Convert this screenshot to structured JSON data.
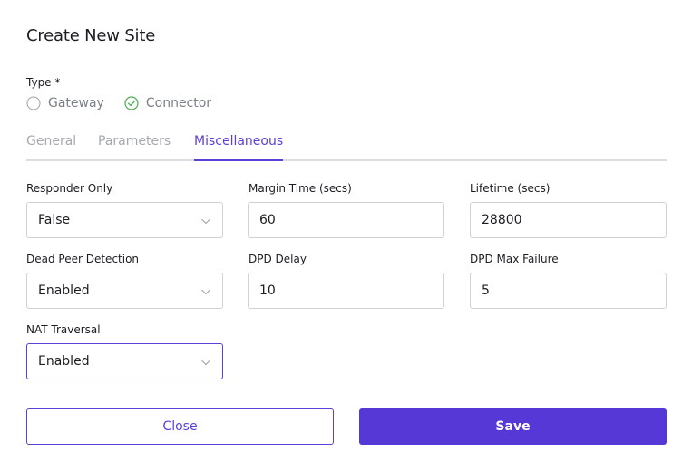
{
  "dialog": {
    "title": "Create New Site"
  },
  "type": {
    "label": "Type *",
    "options": [
      {
        "label": "Gateway",
        "selected": false
      },
      {
        "label": "Connector",
        "selected": true
      }
    ]
  },
  "tabs": [
    {
      "label": "General",
      "active": false
    },
    {
      "label": "Parameters",
      "active": false
    },
    {
      "label": "Miscellaneous",
      "active": true
    }
  ],
  "fields": {
    "responder_only": {
      "label": "Responder Only",
      "value": "False"
    },
    "margin_time": {
      "label": "Margin Time (secs)",
      "value": "60"
    },
    "lifetime": {
      "label": "Lifetime (secs)",
      "value": "28800"
    },
    "dead_peer_detection": {
      "label": "Dead Peer Detection",
      "value": "Enabled"
    },
    "dpd_delay": {
      "label": "DPD Delay",
      "value": "10"
    },
    "dpd_max_failure": {
      "label": "DPD Max Failure",
      "value": "5"
    },
    "nat_traversal": {
      "label": "NAT Traversal",
      "value": "Enabled"
    }
  },
  "buttons": {
    "close": "Close",
    "save": "Save"
  },
  "colors": {
    "accent": "#5538d6",
    "success": "#4caf50",
    "muted": "#a5a8ae"
  }
}
